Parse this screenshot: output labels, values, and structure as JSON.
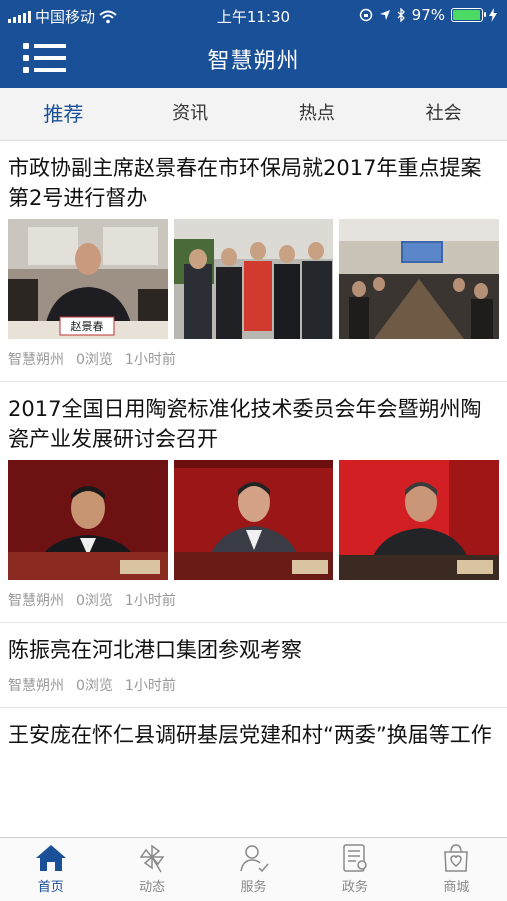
{
  "status_bar": {
    "carrier": "中国移动",
    "time": "上午11:30",
    "battery": "97%",
    "battery_level": 0.97
  },
  "header": {
    "title": "智慧朔州",
    "menu_icon": "list-menu-icon"
  },
  "tabs": [
    {
      "label": "推荐",
      "active": true
    },
    {
      "label": "资讯",
      "active": false
    },
    {
      "label": "热点",
      "active": false
    },
    {
      "label": "社会",
      "active": false
    }
  ],
  "articles": [
    {
      "title": "市政协副主席赵景春在市环保局就2017年重点提案第2号进行督办",
      "source": "智慧朔州",
      "views": "0浏览",
      "time": "1小时前",
      "thumb_labels": [
        "赵景春"
      ]
    },
    {
      "title": "2017全国日用陶瓷标准化技术委员会年会暨朔州陶瓷产业发展研讨会召开",
      "source": "智慧朔州",
      "views": "0浏览",
      "time": "1小时前"
    },
    {
      "title": "陈振亮在河北港口集团参观考察",
      "source": "智慧朔州",
      "views": "0浏览",
      "time": "1小时前"
    },
    {
      "title": "王安庞在怀仁县调研基层党建和村“两委”换届等工作"
    }
  ],
  "bottom_nav": [
    {
      "label": "首页",
      "icon": "home-icon",
      "active": true
    },
    {
      "label": "动态",
      "icon": "pinwheel-icon",
      "active": false
    },
    {
      "label": "服务",
      "icon": "user-service-icon",
      "active": false
    },
    {
      "label": "政务",
      "icon": "document-icon",
      "active": false
    },
    {
      "label": "商城",
      "icon": "shopping-bag-icon",
      "active": false
    }
  ],
  "colors": {
    "brand": "#1a5098",
    "battery": "#4cd964",
    "meta_text": "#999999"
  }
}
